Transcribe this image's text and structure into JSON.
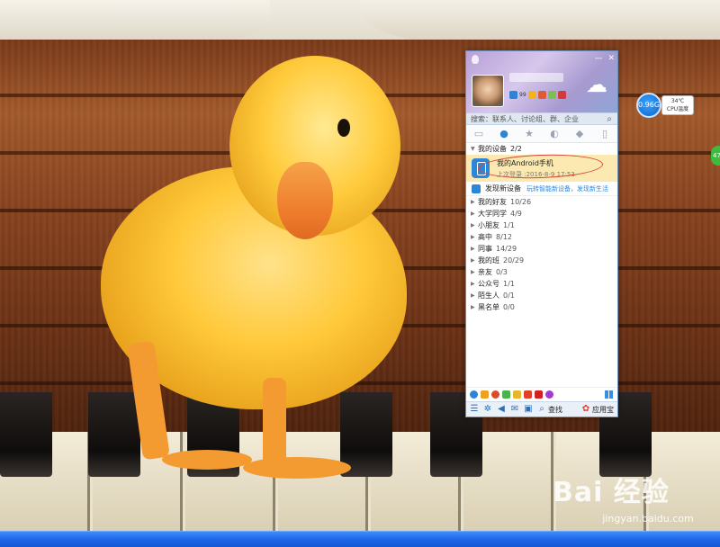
{
  "qq": {
    "search_placeholder": "搜索：联系人、讨论组、群、企业",
    "devices_group": {
      "label": "我的设备",
      "count": "2/2"
    },
    "device": {
      "name": "我的Android手机",
      "last_login": "上次登录 :2016-8-9 17:53"
    },
    "discover": {
      "title": "发现新设备",
      "desc": "玩转智能新设备，发现新生活"
    },
    "groups": [
      {
        "label": "我的好友",
        "count": "10/26"
      },
      {
        "label": "大学同学",
        "count": "4/9"
      },
      {
        "label": "小朋友",
        "count": "1/1"
      },
      {
        "label": "高中",
        "count": "8/12"
      },
      {
        "label": "同事",
        "count": "14/29"
      },
      {
        "label": "我的班",
        "count": "20/29"
      },
      {
        "label": "亲友",
        "count": "0/3"
      },
      {
        "label": "公众号",
        "count": "1/1"
      },
      {
        "label": "陌生人",
        "count": "0/1"
      },
      {
        "label": "黑名单",
        "count": "0/0"
      }
    ],
    "bottom_search": "查找",
    "app_store": "应用宝",
    "status_badge": "99",
    "window_buttons": [
      "—",
      "✕"
    ]
  },
  "widget": {
    "speed": "0.96G",
    "temp": "34℃",
    "temp_label": "CPU温度",
    "green_tab": "47"
  },
  "watermark": {
    "logo": "Bai 经验",
    "url": "jingyan.baidu.com"
  },
  "colors": {
    "accent": "#2f83d6",
    "selected_row": "#fce9b2",
    "taskbar": "#1e67e6",
    "annotation": "#d6453a"
  },
  "icons": [
    "weather-icon",
    "chat-tab-icon",
    "contacts-tab-icon",
    "favorites-tab-icon",
    "groups-tab-icon",
    "bubble-tab-icon",
    "phone-tab-icon",
    "search-icon",
    "menu-icon",
    "settings-icon",
    "volume-icon",
    "mail-icon",
    "grid-icon"
  ]
}
